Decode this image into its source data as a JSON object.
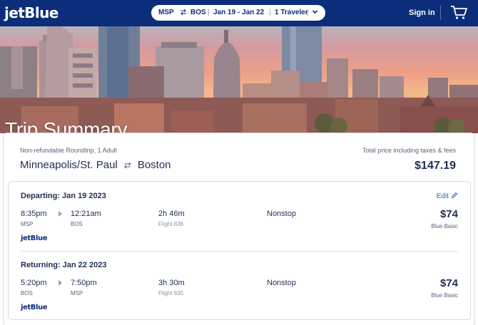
{
  "header": {
    "logo": "jetBlue",
    "search": {
      "origin": "MSP",
      "destination": "BOS",
      "dates": "Jan 19 - Jan 22",
      "travelers": "1 Traveler"
    },
    "sign_in": "Sign in",
    "icons": [
      "swap-icon",
      "chevron-down-icon",
      "cart-icon"
    ]
  },
  "hero": {
    "title": "Trip Summary"
  },
  "summary": {
    "fare_note": "Non-refundable Roundtrip, 1 Adult",
    "origin_city": "Minneapolis/St. Paul",
    "destination_city": "Boston",
    "total_label": "Total price including taxes & fees",
    "total_price": "$147.19"
  },
  "flights": [
    {
      "title": "Departing: Jan 19 2023",
      "edit_label": "Edit",
      "depart_time": "8:35pm",
      "depart_code": "MSP",
      "arrive_time": "12:21am",
      "arrive_code": "BOS",
      "duration": "2h 46m",
      "flight_number": "Flight 836",
      "stops": "Nonstop",
      "price": "$74",
      "fare_class": "Blue Basic",
      "carrier": "jetBlue"
    },
    {
      "title": "Returning: Jan 22 2023",
      "depart_time": "5:20pm",
      "depart_code": "BOS",
      "arrive_time": "7:50pm",
      "arrive_code": "MSP",
      "duration": "3h 30m",
      "flight_number": "Flight 835",
      "stops": "Nonstop",
      "price": "$74",
      "fare_class": "Blue Basic",
      "carrier": "jetBlue"
    }
  ],
  "colors": {
    "brand_navy": "#0c2e7a",
    "text_primary": "#1f2d55",
    "text_secondary": "#5a6178",
    "link_blue": "#3863b5",
    "border": "#d7dbe6"
  }
}
